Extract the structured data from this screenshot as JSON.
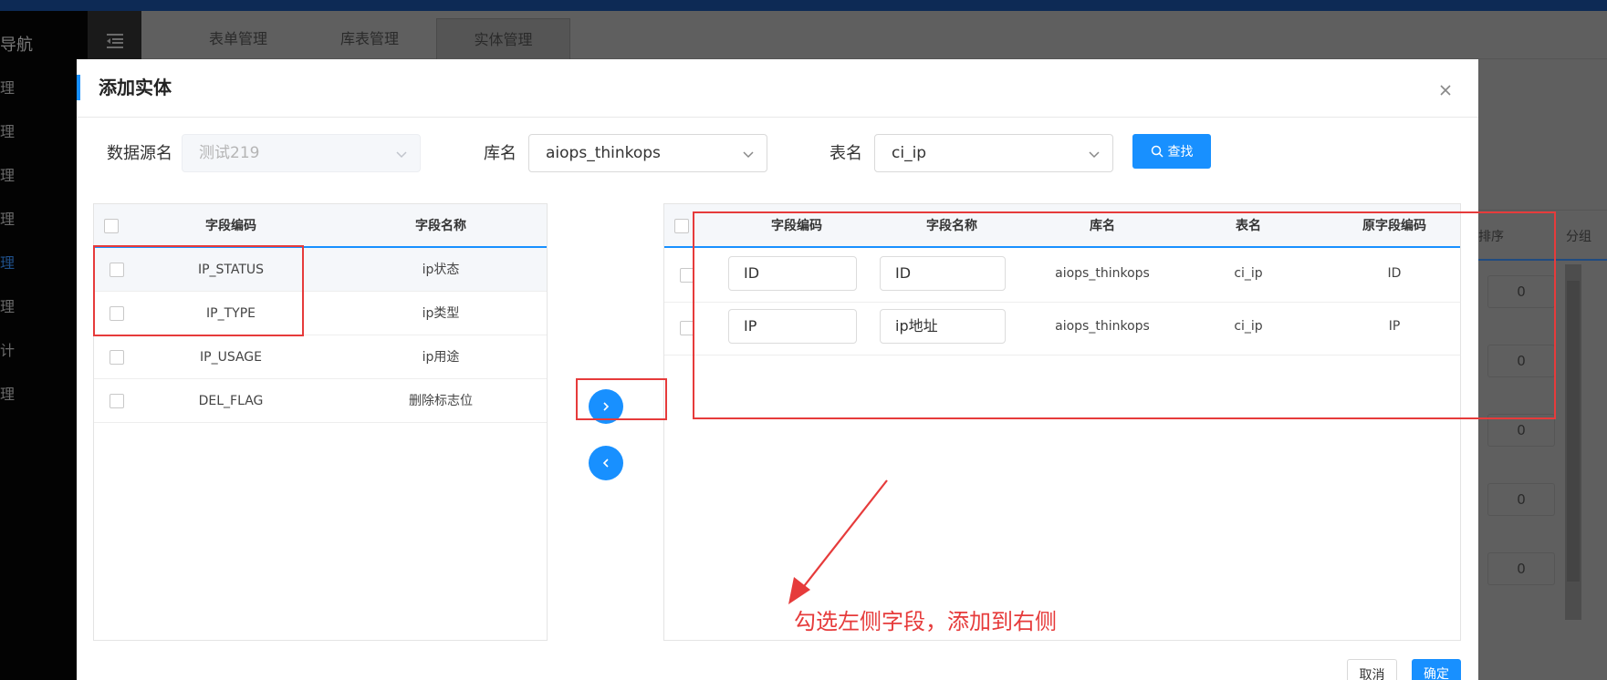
{
  "background": {
    "nav_title": "导航",
    "nav_items": [
      {
        "label": "理",
        "active": false
      },
      {
        "label": "理",
        "active": false
      },
      {
        "label": "理",
        "active": false
      },
      {
        "label": "理",
        "active": false
      },
      {
        "label": "理",
        "active": true
      },
      {
        "label": "理",
        "active": false
      },
      {
        "label": "计",
        "active": false
      },
      {
        "label": "理",
        "active": false
      }
    ],
    "tabs": [
      {
        "label": "表单管理"
      },
      {
        "label": "库表管理"
      },
      {
        "label": "实体管理",
        "active": true
      }
    ],
    "table_headers": {
      "sort": "排序",
      "group": "分组"
    },
    "sort_values": [
      "0",
      "0",
      "0",
      "0",
      "0"
    ]
  },
  "dialog": {
    "title": "添加实体",
    "filters": {
      "datasource_label": "数据源名",
      "datasource_value": "测试219",
      "database_label": "库名",
      "database_value": "aiops_thinkops",
      "table_label": "表名",
      "table_value": "ci_ip",
      "search_label": "查找"
    },
    "left_table": {
      "headers": {
        "code": "字段编码",
        "name": "字段名称"
      },
      "rows": [
        {
          "code": "IP_STATUS",
          "name": "ip状态"
        },
        {
          "code": "IP_TYPE",
          "name": "ip类型"
        },
        {
          "code": "IP_USAGE",
          "name": "ip用途"
        },
        {
          "code": "DEL_FLAG",
          "name": "删除标志位"
        }
      ]
    },
    "right_table": {
      "headers": {
        "code": "字段编码",
        "name": "字段名称",
        "db": "库名",
        "table": "表名",
        "orig": "原字段编码"
      },
      "rows": [
        {
          "code": "ID",
          "name": "ID",
          "db": "aiops_thinkops",
          "table": "ci_ip",
          "orig": "ID"
        },
        {
          "code": "IP",
          "name": "ip地址",
          "db": "aiops_thinkops",
          "table": "ci_ip",
          "orig": "IP"
        }
      ]
    },
    "annotation": "勾选左侧字段，添加到右侧",
    "footer": {
      "cancel": "取消",
      "ok": "确定"
    }
  },
  "colors": {
    "accent": "#1890ff",
    "annotation": "#e63b3b"
  }
}
